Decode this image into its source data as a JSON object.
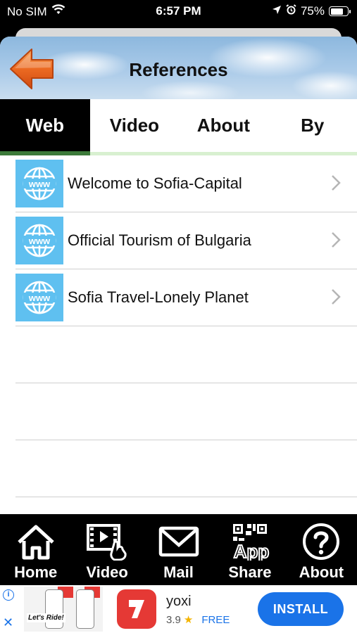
{
  "status_bar": {
    "carrier": "No SIM",
    "time": "6:57 PM",
    "battery": "75%",
    "battery_level": 0.75
  },
  "header": {
    "title": "References"
  },
  "tabs": [
    {
      "label": "Web",
      "active": true
    },
    {
      "label": "Video",
      "active": false
    },
    {
      "label": "About",
      "active": false
    },
    {
      "label": "By",
      "active": false
    }
  ],
  "links": [
    {
      "label": "Welcome to Sofia-Capital",
      "icon": "www-globe-icon"
    },
    {
      "label": "Official Tourism of Bulgaria",
      "icon": "www-globe-icon"
    },
    {
      "label": "Sofia Travel-Lonely Planet",
      "icon": "www-globe-icon"
    }
  ],
  "toolbar": {
    "home": "Home",
    "video": "Video",
    "mail": "Mail",
    "share": "Share",
    "about": "About"
  },
  "ad": {
    "slogan": "Let's Ride!",
    "app_name": "yoxi",
    "rating": "3.9",
    "price": "FREE",
    "install": "INSTALL"
  },
  "colors": {
    "accent_green": "#3c7a3a",
    "www_tile": "#5fc0f0",
    "install_blue": "#1a73e8",
    "back_arrow": "#e8601c"
  }
}
